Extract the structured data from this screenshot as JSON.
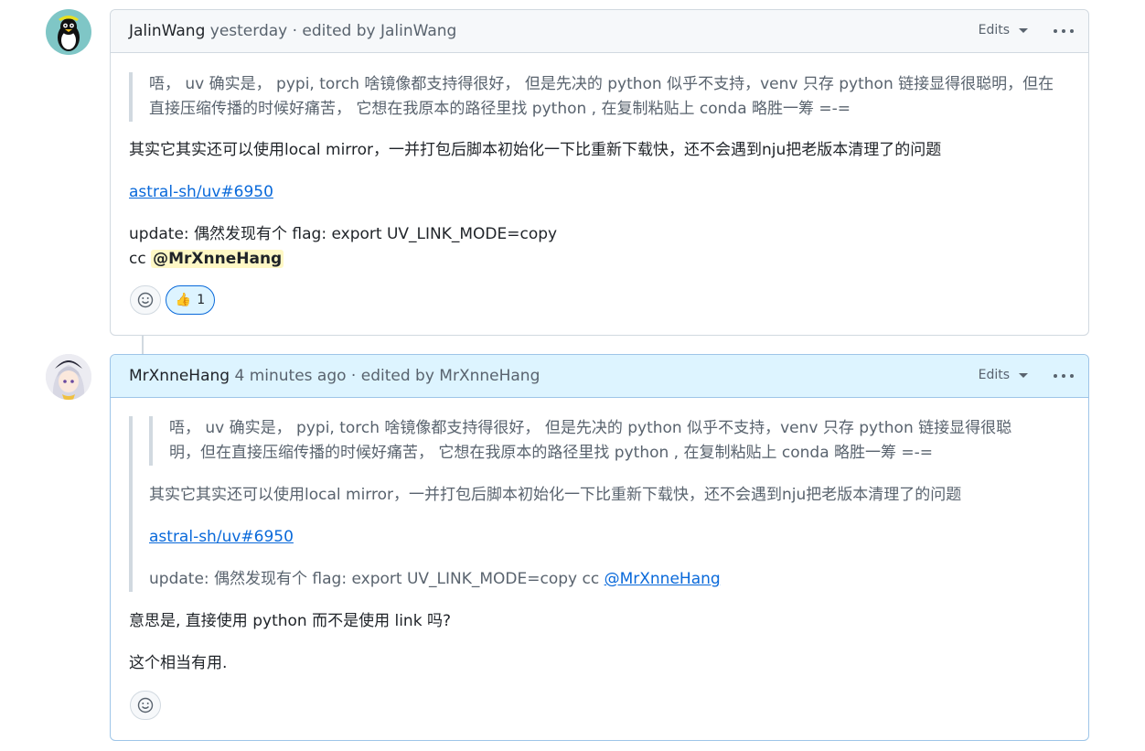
{
  "comments": [
    {
      "author": "JalinWang",
      "meta": " yesterday · edited by JalinWang",
      "edits_label": "Edits",
      "quote_lines": [
        "唔， uv 确实是， pypi, torch 啥镜像都支持得很好， 但是先决的 python 似乎不支持，venv 只存 python 链接显得很聪明，但在",
        "直接压缩传播的时候好痛苦， 它想在我原本的路径里找 python , 在复制粘贴上 conda 略胜一筹 =-="
      ],
      "para1": "其实它其实还可以使用local mirror，一并打包后脚本初始化一下比重新下载快，还不会遇到nju把老版本清理了的问题",
      "link": "astral-sh/uv#6950",
      "update_line": "update: 偶然发现有个 flag: export UV_LINK_MODE=copy",
      "cc_prefix": "cc ",
      "mention": "@MrXnneHang",
      "reactions": {
        "thumbs_emoji": "👍",
        "thumbs_count": "1"
      }
    },
    {
      "author": "MrXnneHang",
      "meta": " 4 minutes ago · edited by MrXnneHang",
      "edits_label": "Edits",
      "quote_lines": [
        "唔， uv 确实是， pypi, torch 啥镜像都支持得很好， 但是先决的 python 似乎不支持，venv 只存 python 链接显得很聪",
        "明，但在直接压缩传播的时候好痛苦， 它想在我原本的路径里找 python , 在复制粘贴上 conda 略胜一筹 =-="
      ],
      "quote_para1": "其实它其实还可以使用local mirror，一并打包后脚本初始化一下比重新下载快，还不会遇到nju把老版本清理了的问题",
      "quote_link": "astral-sh/uv#6950",
      "quote_update": "update: 偶然发现有个 flag: export UV_LINK_MODE=copy cc ",
      "quote_mention": "@MrXnneHang",
      "reply1": "意思是, 直接使用 python 而不是使用 link 吗?",
      "reply2": "这个相当有用."
    }
  ],
  "colors": {
    "link": "#0969da",
    "mention_bg": "#fff8c5",
    "border": "#d1d9e0",
    "header_bg": "#f6f8fa",
    "own_header_bg": "#ddf4ff"
  }
}
